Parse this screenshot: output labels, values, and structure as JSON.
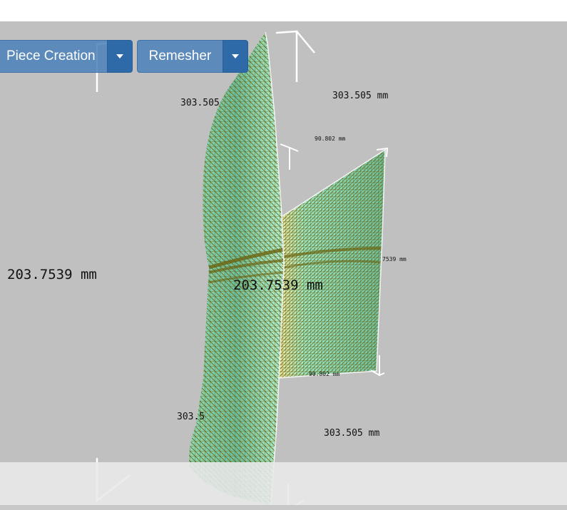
{
  "toolbar": {
    "piece_creation": {
      "label": "Piece Creation",
      "menu_icon": "caret-down"
    },
    "remesher": {
      "label": "Remesher",
      "menu_icon": "caret-down"
    }
  },
  "viewport": {
    "background": "#c0c0c0",
    "mesh_colors": {
      "fill_light": "#98e8c8",
      "fill_mid": "#6cc0a0",
      "wire": "#6b6410"
    },
    "dimension_labels": {
      "width_top_left": "303.505",
      "width_top_right": "303.505 mm",
      "small_width_top": "90.802 mm",
      "height_left": "203.7539 mm",
      "height_center": "203.7539 mm",
      "height_right_partial": "7539 mm",
      "small_width_bottom": "90.802 mm",
      "width_bottom_left": "303.5",
      "width_bottom_right": "303.505 mm"
    }
  }
}
